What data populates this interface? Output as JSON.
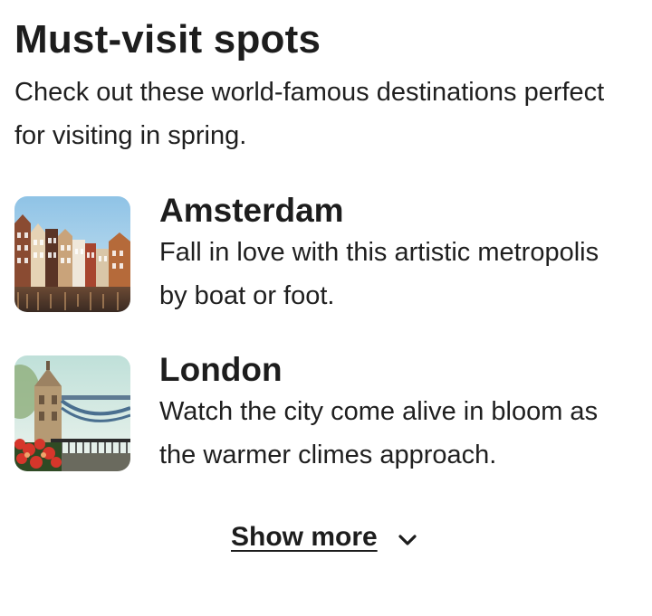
{
  "section": {
    "title": "Must-visit spots",
    "subtitle": "Check out these world-famous destinations perfect for visiting in spring."
  },
  "destinations": [
    {
      "name": "Amsterdam",
      "description": "Fall in love with this artistic metropolis by boat or foot.",
      "image_icon": "amsterdam-canal-houses-photo"
    },
    {
      "name": "London",
      "description": "Watch the city come alive in bloom as the warmer climes approach.",
      "image_icon": "london-tower-bridge-photo"
    }
  ],
  "show_more": {
    "label": "Show more",
    "icon": "chevron-down-icon"
  }
}
